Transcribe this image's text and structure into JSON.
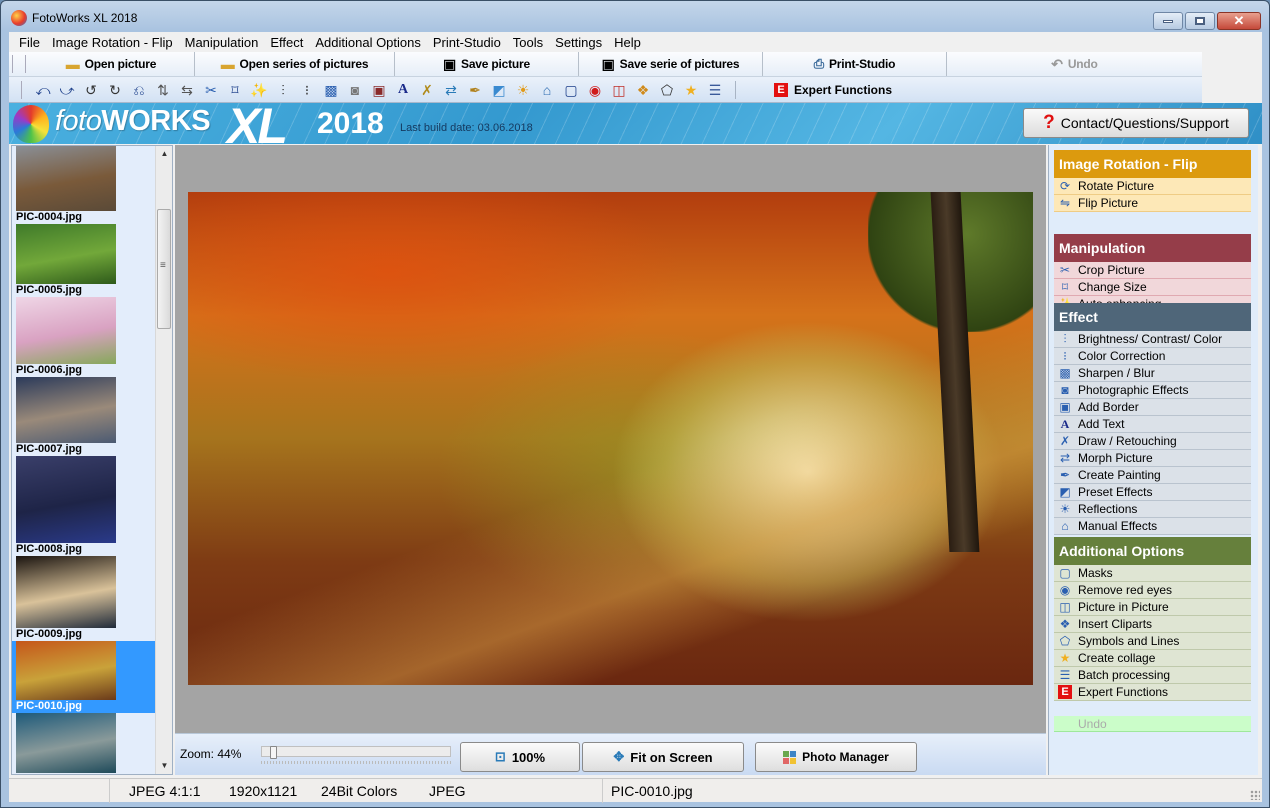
{
  "window": {
    "title": "FotoWorks XL 2018",
    "controls": {
      "minimize": "minimize",
      "maximize": "maximize",
      "close": "close"
    }
  },
  "menubar": [
    {
      "label": "File"
    },
    {
      "label": "Image Rotation - Flip"
    },
    {
      "label": "Manipulation"
    },
    {
      "label": "Effect"
    },
    {
      "label": "Additional Options"
    },
    {
      "label": "Print-Studio"
    },
    {
      "label": "Tools"
    },
    {
      "label": "Settings"
    },
    {
      "label": "Help"
    }
  ],
  "toolbar": {
    "open_picture": "Open picture",
    "open_series": "Open series of pictures",
    "save_picture": "Save picture",
    "save_series": "Save serie of pictures",
    "print_studio": "Print-Studio",
    "undo": "Undo",
    "expert_functions": "Expert Functions",
    "expert_badge": "E",
    "icons": [
      {
        "name": "rotate-left-icon",
        "glyph": "⤺"
      },
      {
        "name": "rotate-right-icon",
        "glyph": "⤻"
      },
      {
        "name": "rotate-ccw-icon",
        "glyph": "↺"
      },
      {
        "name": "rotate-cw-icon",
        "glyph": "↻"
      },
      {
        "name": "rotate-free-icon",
        "glyph": "⎌"
      },
      {
        "name": "flip-vertical-icon",
        "glyph": "⇅"
      },
      {
        "name": "flip-horizontal-icon",
        "glyph": "⇆"
      },
      {
        "name": "crop-icon",
        "glyph": "✂"
      },
      {
        "name": "resize-icon",
        "glyph": "⌑"
      },
      {
        "name": "auto-enhance-icon",
        "glyph": "✨"
      },
      {
        "name": "brightness-contrast-icon",
        "glyph": "⫶"
      },
      {
        "name": "color-correction-icon",
        "glyph": "⁝"
      },
      {
        "name": "sharpen-blur-icon",
        "glyph": "▩"
      },
      {
        "name": "photographic-effects-icon",
        "glyph": "◙"
      },
      {
        "name": "add-border-icon",
        "glyph": "▣"
      },
      {
        "name": "add-text-icon",
        "glyph": "A"
      },
      {
        "name": "draw-retouch-icon",
        "glyph": "✗"
      },
      {
        "name": "morph-picture-icon",
        "glyph": "⇄"
      },
      {
        "name": "create-painting-icon",
        "glyph": "✒"
      },
      {
        "name": "preset-effects-icon",
        "glyph": "◩"
      },
      {
        "name": "reflections-icon",
        "glyph": "☀"
      },
      {
        "name": "manual-effects-icon",
        "glyph": "⌂"
      },
      {
        "name": "masks-icon",
        "glyph": "▢"
      },
      {
        "name": "red-eye-icon",
        "glyph": "◉"
      },
      {
        "name": "picture-in-picture-icon",
        "glyph": "◫"
      },
      {
        "name": "cliparts-icon",
        "glyph": "❖"
      },
      {
        "name": "symbols-lines-icon",
        "glyph": "⬠"
      },
      {
        "name": "collage-star-icon",
        "glyph": "★"
      },
      {
        "name": "batch-processing-icon",
        "glyph": "☰"
      }
    ]
  },
  "banner": {
    "logo_foto": "foto",
    "logo_works": "WORKS",
    "logo_xl": "XL",
    "logo_year": "2018",
    "build_date": "Last build date: 03.06.2018",
    "support_button": "Contact/Questions/Support",
    "support_icon": "?"
  },
  "thumbnails": [
    {
      "name": "PIC-0004.jpg",
      "colors": [
        "#8a8f96",
        "#7a5a3a",
        "#5a4a38"
      ],
      "selected": false
    },
    {
      "name": "PIC-0005.jpg",
      "colors": [
        "#3f7a2a",
        "#72a83a",
        "#2e5a1a"
      ],
      "selected": false
    },
    {
      "name": "PIC-0006.jpg",
      "colors": [
        "#efd6e6",
        "#d9a2c2",
        "#86a85a"
      ],
      "selected": false
    },
    {
      "name": "PIC-0007.jpg",
      "colors": [
        "#2b3a5a",
        "#9a8a7a",
        "#4b5a72"
      ],
      "selected": false
    },
    {
      "name": "PIC-0008.jpg",
      "colors": [
        "#3a3f6a",
        "#1e2447",
        "#2a3a8a"
      ],
      "selected": false
    },
    {
      "name": "PIC-0009.jpg",
      "colors": [
        "#1a1410",
        "#d9c29a",
        "#1f2a3a"
      ],
      "selected": false
    },
    {
      "name": "PIC-0010.jpg",
      "colors": [
        "#c5561a",
        "#c9a23a",
        "#6a3a1a"
      ],
      "selected": true
    },
    {
      "name": "",
      "colors": [
        "#1e5a7a",
        "#8a9a9a",
        "#1e4a5a"
      ],
      "selected": false
    }
  ],
  "viewer": {
    "image_file": "PIC-0010.jpg",
    "zoom_label": "Zoom: 44%",
    "zoom_percent": 44,
    "btn_100": "100%",
    "btn_fit": "Fit on Screen",
    "btn_manager": "Photo Manager"
  },
  "status": {
    "compression": "JPEG  4:1:1",
    "dimensions": "1920x1121",
    "colors": "24Bit Colors",
    "format": "JPEG",
    "filename": "PIC-0010.jpg"
  },
  "side_panel": {
    "groups": [
      {
        "title": "Image Rotation - Flip",
        "header_color": "#dc9a0e",
        "item_bg": "#fde8b7",
        "item_border": "#efcc85",
        "items": [
          {
            "label": "Rotate Picture",
            "icon": "rotate-picture-icon",
            "glyph": "⟳"
          },
          {
            "label": "Flip Picture",
            "icon": "flip-picture-icon",
            "glyph": "⇋"
          }
        ]
      },
      {
        "title": "Manipulation",
        "header_color": "#953d49",
        "item_bg": "#f1d7da",
        "item_border": "#e0a9b1",
        "items": [
          {
            "label": "Crop Picture",
            "icon": "crop-icon",
            "glyph": "✂"
          },
          {
            "label": "Change Size",
            "icon": "resize-icon",
            "glyph": "⌑"
          },
          {
            "label": "Auto enhancing",
            "icon": "auto-enhance-icon",
            "glyph": "✨"
          }
        ]
      },
      {
        "title": "Effect",
        "header_color": "#4f6679",
        "item_bg": "#dbe1e8",
        "item_border": "#b9c3ce",
        "items": [
          {
            "label": "Brightness/ Contrast/ Color",
            "icon": "brightness-contrast-icon",
            "glyph": "⫶"
          },
          {
            "label": "Color Correction",
            "icon": "color-correction-icon",
            "glyph": "⁝"
          },
          {
            "label": "Sharpen / Blur",
            "icon": "sharpen-blur-icon",
            "glyph": "▩"
          },
          {
            "label": "Photographic Effects",
            "icon": "camera-icon",
            "glyph": "◙"
          },
          {
            "label": "Add Border",
            "icon": "add-border-icon",
            "glyph": "▣"
          },
          {
            "label": "Add Text",
            "icon": "add-text-icon",
            "glyph": "A"
          },
          {
            "label": "Draw / Retouching",
            "icon": "draw-retouch-icon",
            "glyph": "✗"
          },
          {
            "label": "Morph Picture",
            "icon": "morph-picture-icon",
            "glyph": "⇄"
          },
          {
            "label": "Create Painting",
            "icon": "pen-nib-icon",
            "glyph": "✒"
          },
          {
            "label": "Preset Effects",
            "icon": "preset-effects-icon",
            "glyph": "◩"
          },
          {
            "label": "Reflections",
            "icon": "reflections-icon",
            "glyph": "☀"
          },
          {
            "label": "Manual Effects",
            "icon": "manual-effects-icon",
            "glyph": "⌂"
          }
        ]
      },
      {
        "title": "Additional Options",
        "header_color": "#66803c",
        "item_bg": "#dfe5d3",
        "item_border": "#bfc9ab",
        "items": [
          {
            "label": "Masks",
            "icon": "masks-icon",
            "glyph": "▢"
          },
          {
            "label": "Remove red eyes",
            "icon": "red-eye-icon",
            "glyph": "◉"
          },
          {
            "label": "Picture in Picture",
            "icon": "picture-in-picture-icon",
            "glyph": "◫"
          },
          {
            "label": "Insert Cliparts",
            "icon": "cliparts-icon",
            "glyph": "❖"
          },
          {
            "label": "Symbols and Lines",
            "icon": "symbols-lines-icon",
            "glyph": "⬠"
          },
          {
            "label": "Create collage",
            "icon": "star-icon",
            "glyph": "★"
          },
          {
            "label": "Batch processing",
            "icon": "batch-processing-icon",
            "glyph": "☰"
          },
          {
            "label": "Expert Functions",
            "icon": "expert-e-icon",
            "glyph": "E"
          }
        ]
      }
    ],
    "undo": "Undo"
  }
}
